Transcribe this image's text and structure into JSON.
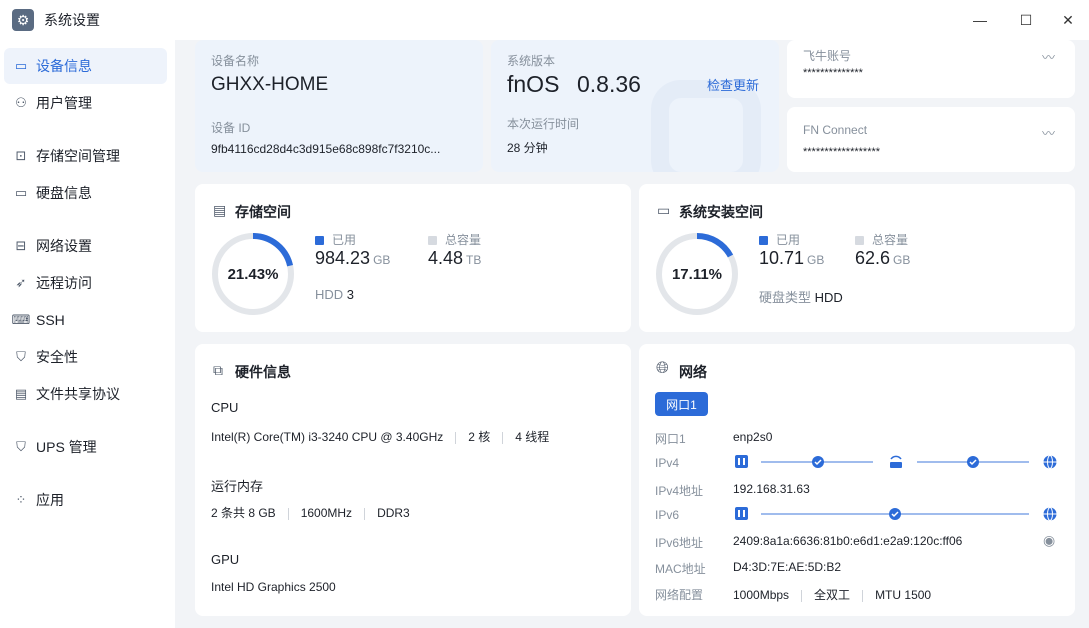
{
  "window": {
    "title": "系统设置",
    "minimize": "—",
    "maximize": "☐",
    "close": "✕"
  },
  "sidebar": {
    "items": [
      {
        "label": "设备信息",
        "icon": "device-icon",
        "glyph": "▭"
      },
      {
        "label": "用户管理",
        "icon": "user-icon",
        "glyph": "⚇"
      },
      {
        "label": "存储空间管理",
        "icon": "storage-icon",
        "glyph": "⊡"
      },
      {
        "label": "硬盘信息",
        "icon": "disk-icon",
        "glyph": "▭"
      },
      {
        "label": "网络设置",
        "icon": "network-icon",
        "glyph": "⊟"
      },
      {
        "label": "远程访问",
        "icon": "send-icon",
        "glyph": "➶"
      },
      {
        "label": "SSH",
        "icon": "ssh-icon",
        "glyph": "⌨"
      },
      {
        "label": "安全性",
        "icon": "shield-icon",
        "glyph": "⛉"
      },
      {
        "label": "文件共享协议",
        "icon": "file-icon",
        "glyph": "▤"
      },
      {
        "label": "UPS 管理",
        "icon": "ups-icon",
        "glyph": "⛉"
      },
      {
        "label": "应用",
        "icon": "apps-icon",
        "glyph": "⁘"
      }
    ]
  },
  "device": {
    "name_label": "设备名称",
    "name": "GHXX-HOME",
    "id_label": "设备 ID",
    "id": "9fb4116cd28d4c3d915e68c898fc7f3210c..."
  },
  "system": {
    "version_label": "系统版本",
    "os": "fnOS",
    "version": "0.8.36",
    "check_update": "检查更新",
    "uptime_label": "本次运行时间",
    "uptime": "28 分钟"
  },
  "account": {
    "label": "飞牛账号",
    "value": "**************"
  },
  "fnconnect": {
    "label": "FN Connect",
    "value": "******************"
  },
  "storage": {
    "title": "存储空间",
    "percent": "21.43%",
    "fraction": 0.2143,
    "used_label": "已用",
    "used_value": "984.23",
    "used_unit": "GB",
    "total_label": "总容量",
    "total_value": "4.48",
    "total_unit": "TB",
    "disk_label": "HDD",
    "disk_count": "3"
  },
  "sysinstall": {
    "title": "系统安装空间",
    "percent": "17.11%",
    "fraction": 0.1711,
    "used_label": "已用",
    "used_value": "10.71",
    "used_unit": "GB",
    "total_label": "总容量",
    "total_value": "62.6",
    "total_unit": "GB",
    "disk_type_label": "硬盘类型",
    "disk_type": "HDD"
  },
  "hardware": {
    "title": "硬件信息",
    "cpu_label": "CPU",
    "cpu_model": "Intel(R) Core(TM) i3-3240 CPU @ 3.40GHz",
    "cpu_cores": "2 核",
    "cpu_threads": "4 线程",
    "mem_label": "运行内存",
    "mem_sticks": "2 条共 8 GB",
    "mem_freq": "1600MHz",
    "mem_type": "DDR3",
    "gpu_label": "GPU",
    "gpu_model": "Intel HD Graphics 2500"
  },
  "network": {
    "title": "网络",
    "tab": "网口1",
    "rows": {
      "port_label": "网口1",
      "port_value": "enp2s0",
      "ipv4_label": "IPv4",
      "ipv4addr_label": "IPv4地址",
      "ipv4addr_value": "192.168.31.63",
      "ipv6_label": "IPv6",
      "ipv6addr_label": "IPv6地址",
      "ipv6addr_value": "2409:8a1a:6636:81b0:e6d1:e2a9:120c:ff06",
      "mac_label": "MAC地址",
      "mac_value": "D4:3D:7E:AE:5D:B2",
      "config_label": "网络配置",
      "speed": "1000Mbps",
      "duplex": "全双工",
      "mtu": "MTU 1500"
    }
  },
  "colors": {
    "accent": "#2c6bd8",
    "ring_bg": "#e3e6ea",
    "legend_total": "#d6dae0"
  }
}
